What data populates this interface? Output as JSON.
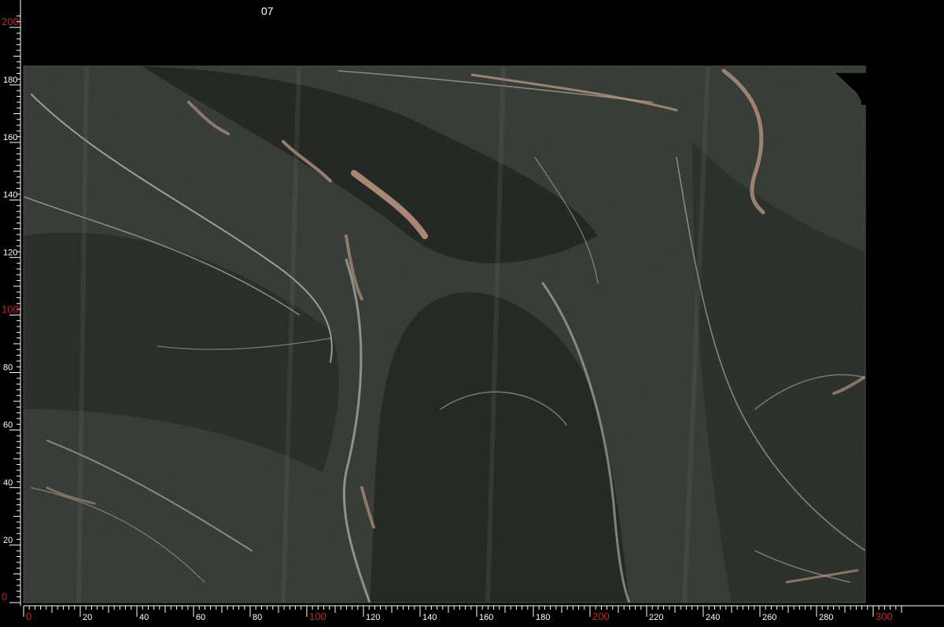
{
  "slab": {
    "label": "07",
    "base_color": "#2b302b",
    "vein_colors": [
      "#c9a08a",
      "#d8cfc4",
      "#8c9a8c"
    ]
  },
  "rulers": {
    "line_color": "#ffffff",
    "label_color": "#ffffff",
    "major_label_color": "#d42020",
    "x_axis": {
      "min": 0,
      "max": 310,
      "major_every": 100,
      "labeled_every": 20,
      "labels": [
        "0",
        "20",
        "40",
        "60",
        "80",
        "100",
        "120",
        "140",
        "160",
        "180",
        "200",
        "220",
        "240",
        "260",
        "280",
        "300"
      ]
    },
    "y_axis": {
      "min": 0,
      "max": 205,
      "major_every": 100,
      "labeled_every": 20,
      "labels": [
        "0",
        "20",
        "40",
        "60",
        "80",
        "100",
        "120",
        "140",
        "160",
        "180",
        "200"
      ]
    }
  }
}
